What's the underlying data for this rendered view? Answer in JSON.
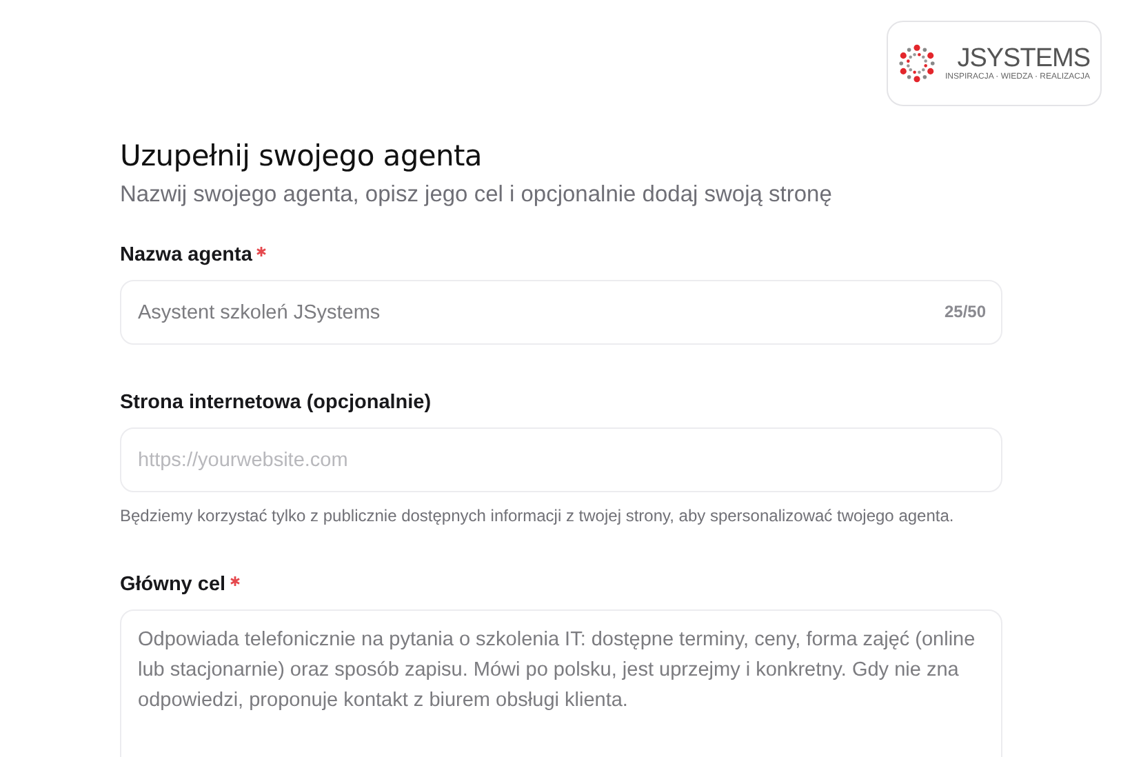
{
  "logo": {
    "name": "JSYSTEMS",
    "tagline": "INSPIRACJA · WIEDZA · REALIZACJA"
  },
  "title": "Uzupełnij swojego agenta",
  "subtitle": "Nazwij swojego agenta, opisz jego cel i opcjonalnie dodaj swoją stronę",
  "fields": [
    {
      "kind": "input",
      "label": "Nazwa agenta",
      "required": true,
      "value": "Asystent szkoleń JSystems",
      "counter": "25/50"
    },
    {
      "kind": "input",
      "label": "Strona internetowa (opcjonalnie)",
      "required": false,
      "placeholder": "https://yourwebsite.com",
      "help": "Będziemy korzystać tylko z publicznie dostępnych informacji z twojej strony, aby spersonalizować twojego agenta."
    },
    {
      "kind": "textarea",
      "label": "Główny cel",
      "required": true,
      "value": "Odpowiada telefonicznie na pytania o szkolenia IT: dostępne terminy, ceny, forma zajęć (online lub stacjonarnie) oraz sposób zapisu. Mówi po polsku, jest uprzejmy i konkretny. Gdy nie zna odpowiedzi, proponuje kontakt z biurem obsługi klienta."
    }
  ]
}
